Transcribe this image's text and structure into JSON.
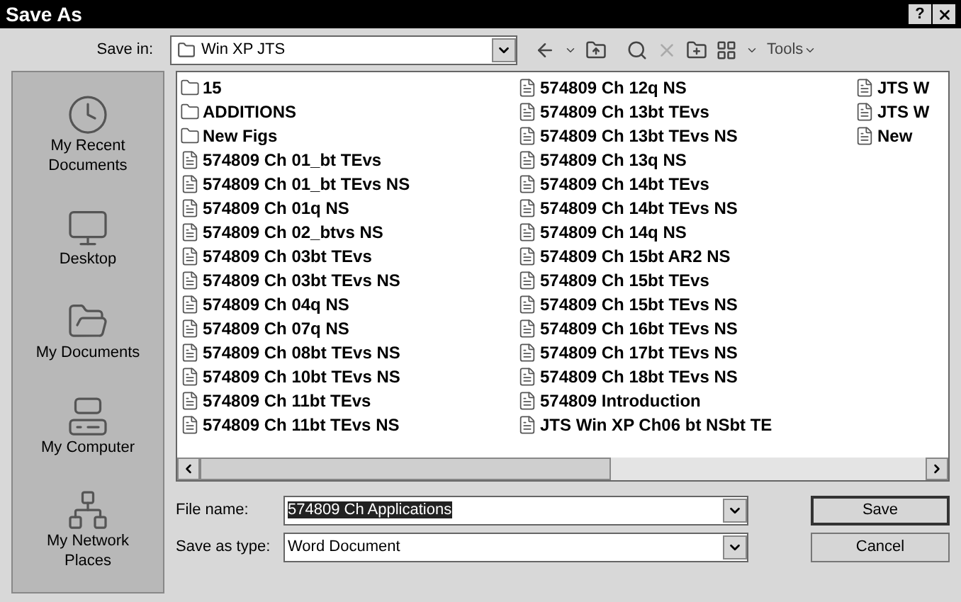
{
  "window": {
    "title": "Save As",
    "help": "?"
  },
  "save_in": {
    "label": "Save in:",
    "value": "Win XP JTS"
  },
  "toolbar": {
    "tools": "Tools"
  },
  "places": [
    {
      "label": "My Recent Documents",
      "kind": "recent"
    },
    {
      "label": "Desktop",
      "kind": "desktop"
    },
    {
      "label": "My Documents",
      "kind": "documents"
    },
    {
      "label": "My Computer",
      "kind": "computer"
    },
    {
      "label": "My Network Places",
      "kind": "network"
    }
  ],
  "files": [
    [
      {
        "name": "15",
        "kind": "folder"
      },
      {
        "name": "ADDITIONS",
        "kind": "folder"
      },
      {
        "name": "New Figs",
        "kind": "folder"
      },
      {
        "name": "574809 Ch 01_bt TEvs",
        "kind": "doc"
      },
      {
        "name": "574809 Ch 01_bt TEvs NS",
        "kind": "doc"
      },
      {
        "name": "574809 Ch 01q NS",
        "kind": "doc"
      },
      {
        "name": "574809 Ch 02_btvs NS",
        "kind": "doc"
      },
      {
        "name": "574809 Ch 03bt TEvs",
        "kind": "doc"
      },
      {
        "name": "574809 Ch 03bt TEvs NS",
        "kind": "doc"
      },
      {
        "name": "574809 Ch 04q NS",
        "kind": "doc"
      },
      {
        "name": "574809 Ch 07q NS",
        "kind": "doc"
      },
      {
        "name": "574809 Ch 08bt TEvs NS",
        "kind": "doc"
      },
      {
        "name": "574809 Ch 10bt TEvs NS",
        "kind": "doc"
      },
      {
        "name": "574809 Ch 11bt TEvs",
        "kind": "doc"
      },
      {
        "name": "574809 Ch 11bt TEvs NS",
        "kind": "doc"
      }
    ],
    [
      {
        "name": "574809 Ch 12q NS",
        "kind": "doc"
      },
      {
        "name": "574809 Ch 13bt TEvs",
        "kind": "doc"
      },
      {
        "name": "574809 Ch 13bt TEvs NS",
        "kind": "doc"
      },
      {
        "name": "574809 Ch 13q NS",
        "kind": "doc"
      },
      {
        "name": "574809 Ch 14bt TEvs",
        "kind": "doc"
      },
      {
        "name": "574809 Ch 14bt TEvs NS",
        "kind": "doc"
      },
      {
        "name": "574809 Ch 14q NS",
        "kind": "doc"
      },
      {
        "name": "574809 Ch 15bt AR2 NS",
        "kind": "doc"
      },
      {
        "name": "574809 Ch 15bt TEvs",
        "kind": "doc"
      },
      {
        "name": "574809 Ch 15bt TEvs NS",
        "kind": "doc"
      },
      {
        "name": "574809 Ch 16bt TEvs NS",
        "kind": "doc"
      },
      {
        "name": "574809 Ch 17bt TEvs NS",
        "kind": "doc"
      },
      {
        "name": "574809 Ch 18bt TEvs NS",
        "kind": "doc"
      },
      {
        "name": "574809 Introduction",
        "kind": "doc"
      },
      {
        "name": "JTS Win XP Ch06 bt NSbt TE",
        "kind": "doc"
      }
    ],
    [
      {
        "name": "JTS W",
        "kind": "doc"
      },
      {
        "name": "JTS W",
        "kind": "doc"
      },
      {
        "name": "New",
        "kind": "doc"
      }
    ]
  ],
  "file_name": {
    "label": "File name:",
    "value": "574809 Ch Applications",
    "selected": true
  },
  "save_as_type": {
    "label": "Save as type:",
    "value": "Word Document"
  },
  "buttons": [
    "Save",
    "Cancel"
  ]
}
